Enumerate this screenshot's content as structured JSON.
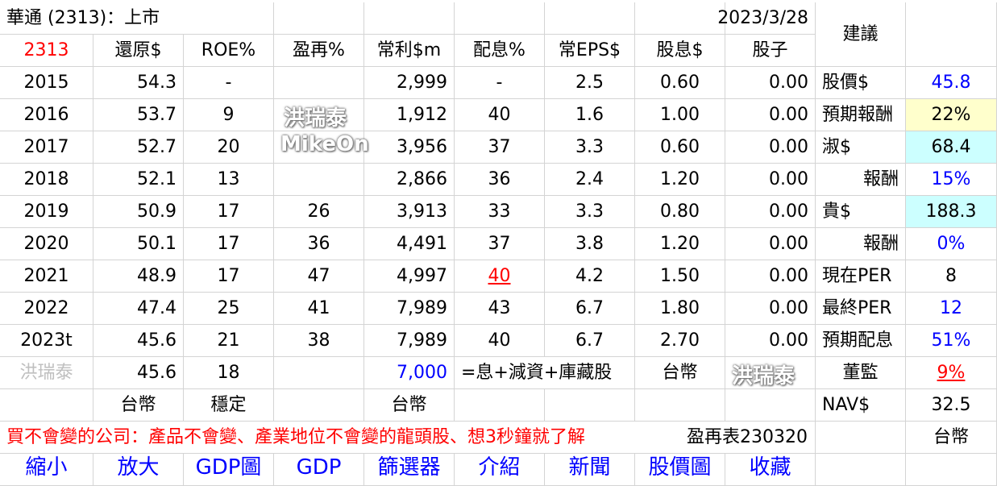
{
  "header": {
    "company": "華通 (2313)：上市",
    "date": "2023/3/28",
    "suggest_label": "建議",
    "code": "2313",
    "cols": [
      "還原$",
      "ROE%",
      "盈再%",
      "常利$m",
      "配息%",
      "常EPS$",
      "股息$",
      "股子"
    ]
  },
  "rows": [
    {
      "year": "2015",
      "restored": "54.3",
      "roe": "-",
      "reinvest": "",
      "profit": "2,999",
      "payout": "-",
      "eps": "2.5",
      "dividend": "0.60",
      "stock_div": "0.00"
    },
    {
      "year": "2016",
      "restored": "53.7",
      "roe": "9",
      "reinvest": "",
      "profit": "1,912",
      "payout": "40",
      "eps": "1.6",
      "dividend": "1.00",
      "stock_div": "0.00"
    },
    {
      "year": "2017",
      "restored": "52.7",
      "roe": "20",
      "reinvest": "",
      "profit": "3,956",
      "payout": "37",
      "eps": "3.3",
      "dividend": "0.60",
      "stock_div": "0.00"
    },
    {
      "year": "2018",
      "restored": "52.1",
      "roe": "13",
      "reinvest": "",
      "profit": "2,866",
      "payout": "36",
      "eps": "2.4",
      "dividend": "1.20",
      "stock_div": "0.00"
    },
    {
      "year": "2019",
      "restored": "50.9",
      "roe": "17",
      "reinvest": "26",
      "profit": "3,913",
      "payout": "33",
      "eps": "3.3",
      "dividend": "0.80",
      "stock_div": "0.00"
    },
    {
      "year": "2020",
      "restored": "50.1",
      "roe": "17",
      "reinvest": "36",
      "profit": "4,491",
      "payout": "37",
      "eps": "3.8",
      "dividend": "1.20",
      "stock_div": "0.00"
    },
    {
      "year": "2021",
      "restored": "48.9",
      "roe": "17",
      "reinvest": "47",
      "profit": "4,997",
      "payout": "40",
      "eps": "4.2",
      "dividend": "1.50",
      "stock_div": "0.00"
    },
    {
      "year": "2022",
      "restored": "47.4",
      "roe": "25",
      "reinvest": "41",
      "profit": "7,989",
      "payout": "43",
      "eps": "6.7",
      "dividend": "1.80",
      "stock_div": "0.00"
    },
    {
      "year": "2023t",
      "restored": "45.6",
      "roe": "21",
      "reinvest": "38",
      "profit": "7,989",
      "payout": "40",
      "eps": "6.7",
      "dividend": "2.70",
      "stock_div": "0.00"
    }
  ],
  "summary": {
    "author": "洪瑞泰",
    "restored": "45.6",
    "roe": "18",
    "profit": "7,000",
    "payout_note": "=息+減資+庫藏股",
    "currency": "台幣"
  },
  "units": {
    "restored": "台幣",
    "roe": "穩定",
    "profit": "台幣"
  },
  "side": [
    {
      "label": "股價$",
      "value": "45.8"
    },
    {
      "label": "預期報酬",
      "value": "22%"
    },
    {
      "label": "淑$",
      "value": "68.4"
    },
    {
      "label": "報酬",
      "value": "15%"
    },
    {
      "label": "貴$",
      "value": "188.3"
    },
    {
      "label": "報酬",
      "value": "0%"
    },
    {
      "label": "現在PER",
      "value": "8"
    },
    {
      "label": "最終PER",
      "value": "12"
    },
    {
      "label": "預期配息",
      "value": "51%"
    },
    {
      "label": "董監",
      "value": "9%"
    },
    {
      "label": "NAV$",
      "value": "32.5"
    },
    {
      "label": "",
      "value": "台幣"
    }
  ],
  "slogan": "買不會變的公司：產品不會變、產業地位不會變的龍頭股、想3秒鐘就了解",
  "table_code": "盈再表230320",
  "watermarks": [
    "洪瑞泰",
    "MikeOn",
    "洪瑞泰"
  ],
  "nav_links": [
    "縮小",
    "放大",
    "GDP圖",
    "GDP",
    "篩選器",
    "介紹",
    "新聞",
    "股價圖",
    "收藏"
  ],
  "colors": {
    "red": "#ff0000",
    "blue": "#0000ff",
    "yellow_fill": "#ffffcc",
    "cyan_fill": "#ccffff",
    "gray": "#bfbfbf"
  }
}
